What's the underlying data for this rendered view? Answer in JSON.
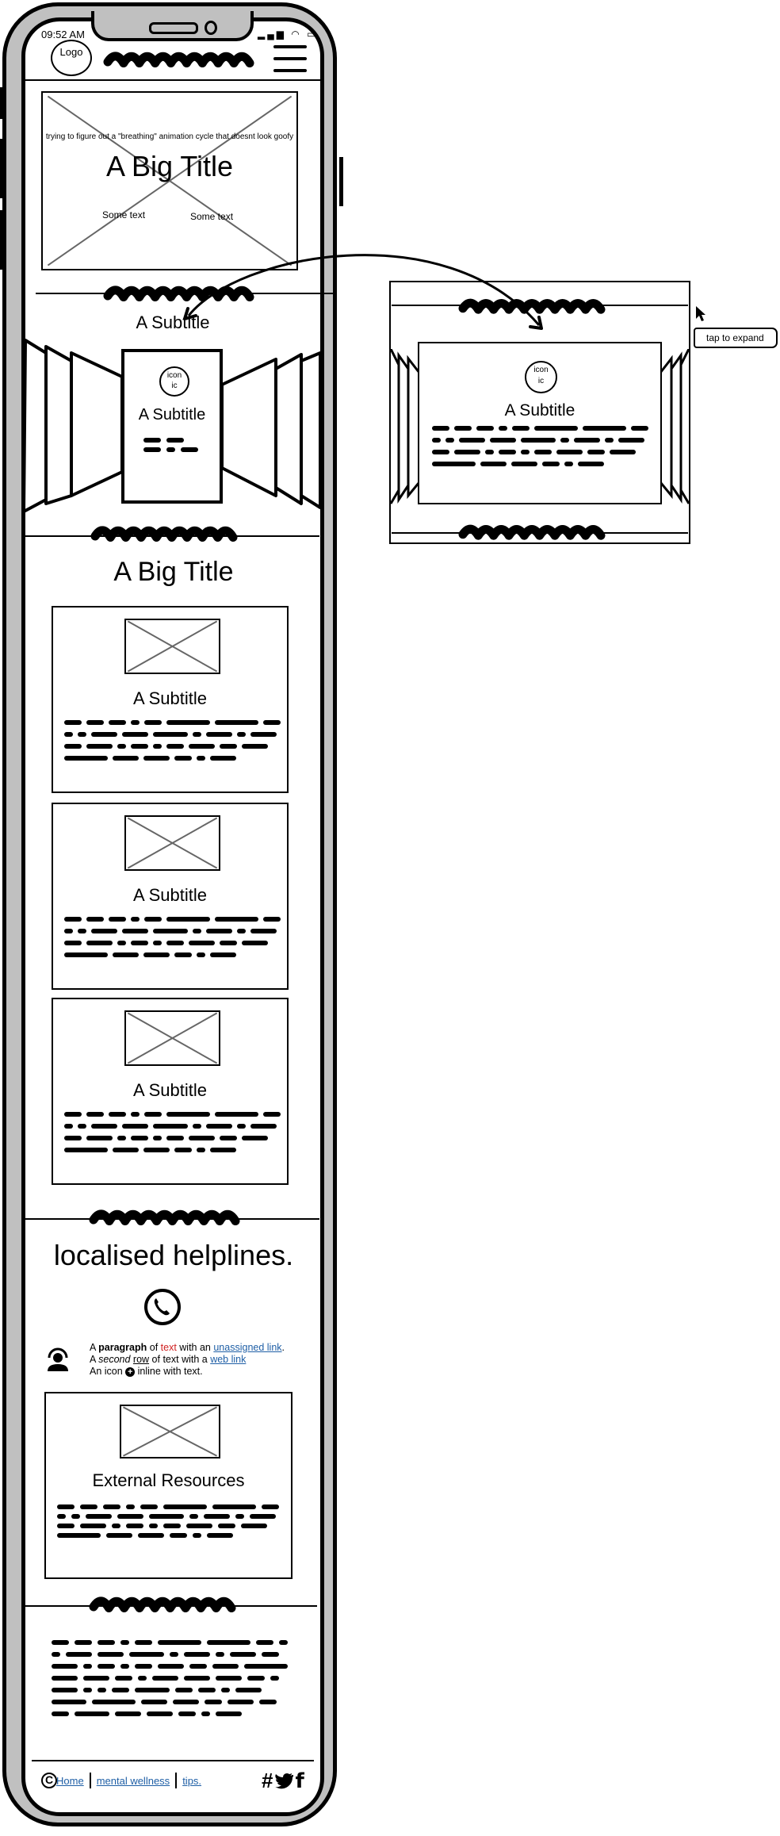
{
  "status_bar": {
    "time": "09:52 AM",
    "icons": "signal wifi battery"
  },
  "header": {
    "logo": "Logo",
    "menu_icon": "hamburger-icon"
  },
  "hero": {
    "caption": "trying to figure out a \"breathing\" animation cycle that doesnt look goofy",
    "title": "A Big Title",
    "text_left": "Some text",
    "text_right": "Some text"
  },
  "carousel": {
    "heading": "A Subtitle",
    "card": {
      "icon": "icon",
      "icon_sub": "ic",
      "title": "A Subtitle"
    }
  },
  "section2": {
    "title": "A Big Title",
    "cards": [
      {
        "title": "A Subtitle"
      },
      {
        "title": "A Subtitle"
      },
      {
        "title": "A Subtitle"
      }
    ]
  },
  "helplines": {
    "title": "localised helplines.",
    "para": {
      "l1_a": "A ",
      "l1_bold": "paragraph",
      "l1_b": " of ",
      "l1_red": "text",
      "l1_c": " with an ",
      "l1_link": "unassigned link",
      "l1_d": ".",
      "l2_a": "A ",
      "l2_italic": "second",
      "l2_b": " ",
      "l2_under": "row",
      "l2_c": " of text with a ",
      "l2_link": "web link",
      "l3_a": "An icon ",
      "l3_b": " inline with text."
    }
  },
  "resources": {
    "title": "External Resources"
  },
  "footer": {
    "links": [
      "Home",
      "mental wellness",
      "tips."
    ],
    "social": [
      "#",
      "twitter",
      "f"
    ]
  },
  "expanded": {
    "card": {
      "icon": "icon",
      "icon_sub": "ic",
      "title": "A Subtitle"
    },
    "tooltip": "tap to expand"
  },
  "colors": {
    "link": "#1f5fa6",
    "red": "#d02020",
    "frame": "#c0c0c0"
  }
}
